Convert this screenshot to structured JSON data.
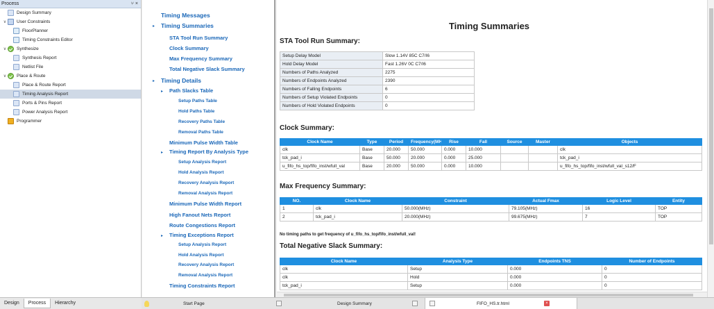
{
  "process_panel": {
    "title": "Process",
    "controls": "⑂ ×",
    "items": [
      {
        "label": "Design Summary"
      },
      {
        "label": "User Constraints"
      },
      {
        "label": "FloorPlanner"
      },
      {
        "label": "Timing Constraints Editor"
      },
      {
        "label": "Synthesize"
      },
      {
        "label": "Synthesis Report"
      },
      {
        "label": "Netlist File"
      },
      {
        "label": "Place & Route"
      },
      {
        "label": "Place & Route Report"
      },
      {
        "label": "Timing Analysis Report"
      },
      {
        "label": "Ports & Pins Report"
      },
      {
        "label": "Power Analysis Report"
      },
      {
        "label": "Programmer"
      }
    ]
  },
  "bottom_tabs": {
    "left": [
      "Design",
      "Process",
      "Hierarchy"
    ],
    "start_page": "Start Page",
    "design_summary": "Design Summary",
    "fifo": "FIFO_HS.tr.html"
  },
  "nav": {
    "timing_messages": "Timing Messages",
    "timing_summaries": "Timing Summaries",
    "sta_tool_run_summary": "STA Tool Run Summary",
    "clock_summary": "Clock Summary",
    "max_frequency_summary": "Max Frequency Summary",
    "total_negative_slack_summary": "Total Negative Slack Summary",
    "timing_details": "Timing Details",
    "path_slacks_table": "Path Slacks Table",
    "setup_paths_table": "Setup Paths Table",
    "hold_paths_table": "Hold Paths Table",
    "recovery_paths_table": "Recovery Paths Table",
    "removal_paths_table": "Removal Paths Table",
    "minimum_pulse_width_table": "Minimum Pulse Width Table",
    "timing_report_by_analysis_type": "Timing Report By Analysis Type",
    "setup_analysis_report_1": "Setup Analysis Report",
    "hold_analysis_report_1": "Hold Analysis Report",
    "recovery_analysis_report_1": "Recovery Analysis Report",
    "removal_analysis_report_1": "Removal Analysis Report",
    "minimum_pulse_width_report": "Minimum Pulse Width Report",
    "high_fanout_nets_report": "High Fanout Nets Report",
    "route_congestions_report": "Route Congestions Report",
    "timing_exceptions_report": "Timing Exceptions Report",
    "setup_analysis_report_2": "Setup Analysis Report",
    "hold_analysis_report_2": "Hold Analysis Report",
    "recovery_analysis_report_2": "Recovery Analysis Report",
    "removal_analysis_report_2": "Removal Analysis Report",
    "timing_constraints_report": "Timing Constraints Report"
  },
  "report": {
    "title": "Timing Summaries",
    "sta_title": "STA Tool Run Summary:",
    "sta_rows": [
      [
        "Setup Delay Model",
        "Slow 1.14V 85C C7/I6"
      ],
      [
        "Hold Delay Model",
        "Fast 1.26V 0C C7/I6"
      ],
      [
        "Numbers of Paths Analyzed",
        "2275"
      ],
      [
        "Numbers of Endpoints Analyzed",
        "2390"
      ],
      [
        "Numbers of Falling Endpoints",
        "6"
      ],
      [
        "Numbers of Setup Violated Endpoints",
        "0"
      ],
      [
        "Numbers of Hold Violated Endpoints",
        "0"
      ]
    ],
    "clock_title": "Clock Summary:",
    "clock_headers": [
      "Clock Name",
      "Type",
      "Period",
      "Frequency(MHz)",
      "Rise",
      "Fall",
      "Source",
      "Master",
      "Objects"
    ],
    "clock_rows": [
      [
        "clk",
        "Base",
        "20.000",
        "50.000",
        "0.000",
        "10.000",
        "",
        "",
        "clk"
      ],
      [
        "tck_pad_i",
        "Base",
        "50.000",
        "20.000",
        "0.000",
        "25.000",
        "",
        "",
        "tck_pad_i"
      ],
      [
        "u_fifo_hs_top/fifo_inst/wfull_val",
        "Base",
        "20.000",
        "50.000",
        "0.000",
        "10.000",
        "",
        "",
        "u_fifo_hs_top/fifo_inst/wfull_val_s12/F"
      ]
    ],
    "maxfreq_title": "Max Frequency Summary:",
    "maxfreq_headers": [
      "NO.",
      "Clock Name",
      "Constraint",
      "Actual Fmax",
      "Logic Level",
      "Entity"
    ],
    "maxfreq_rows": [
      [
        "1",
        "clk",
        "50.000(MHz)",
        "79.105(MHz)",
        "16",
        "TOP"
      ],
      [
        "2",
        "tck_pad_i",
        "20.000(MHz)",
        "99.675(MHz)",
        "7",
        "TOP"
      ]
    ],
    "maxfreq_note": "No timing paths to get frequency of u_fifo_hs_top/fifo_inst/wfull_val!",
    "tns_title": "Total Negative Slack Summary:",
    "tns_headers": [
      "Clock Name",
      "Analysis Type",
      "Endpoints TNS",
      "Number of Endpoints"
    ],
    "tns_rows": [
      [
        "clk",
        "Setup",
        "0.000",
        "0"
      ],
      [
        "clk",
        "Hold",
        "0.000",
        "0"
      ],
      [
        "tck_pad_i",
        "Setup",
        "0.000",
        "0"
      ]
    ]
  },
  "colors": {
    "header_blue": "#1f8fe0",
    "link_blue": "#1a67b8",
    "selected_row": "#cfd9e6"
  }
}
